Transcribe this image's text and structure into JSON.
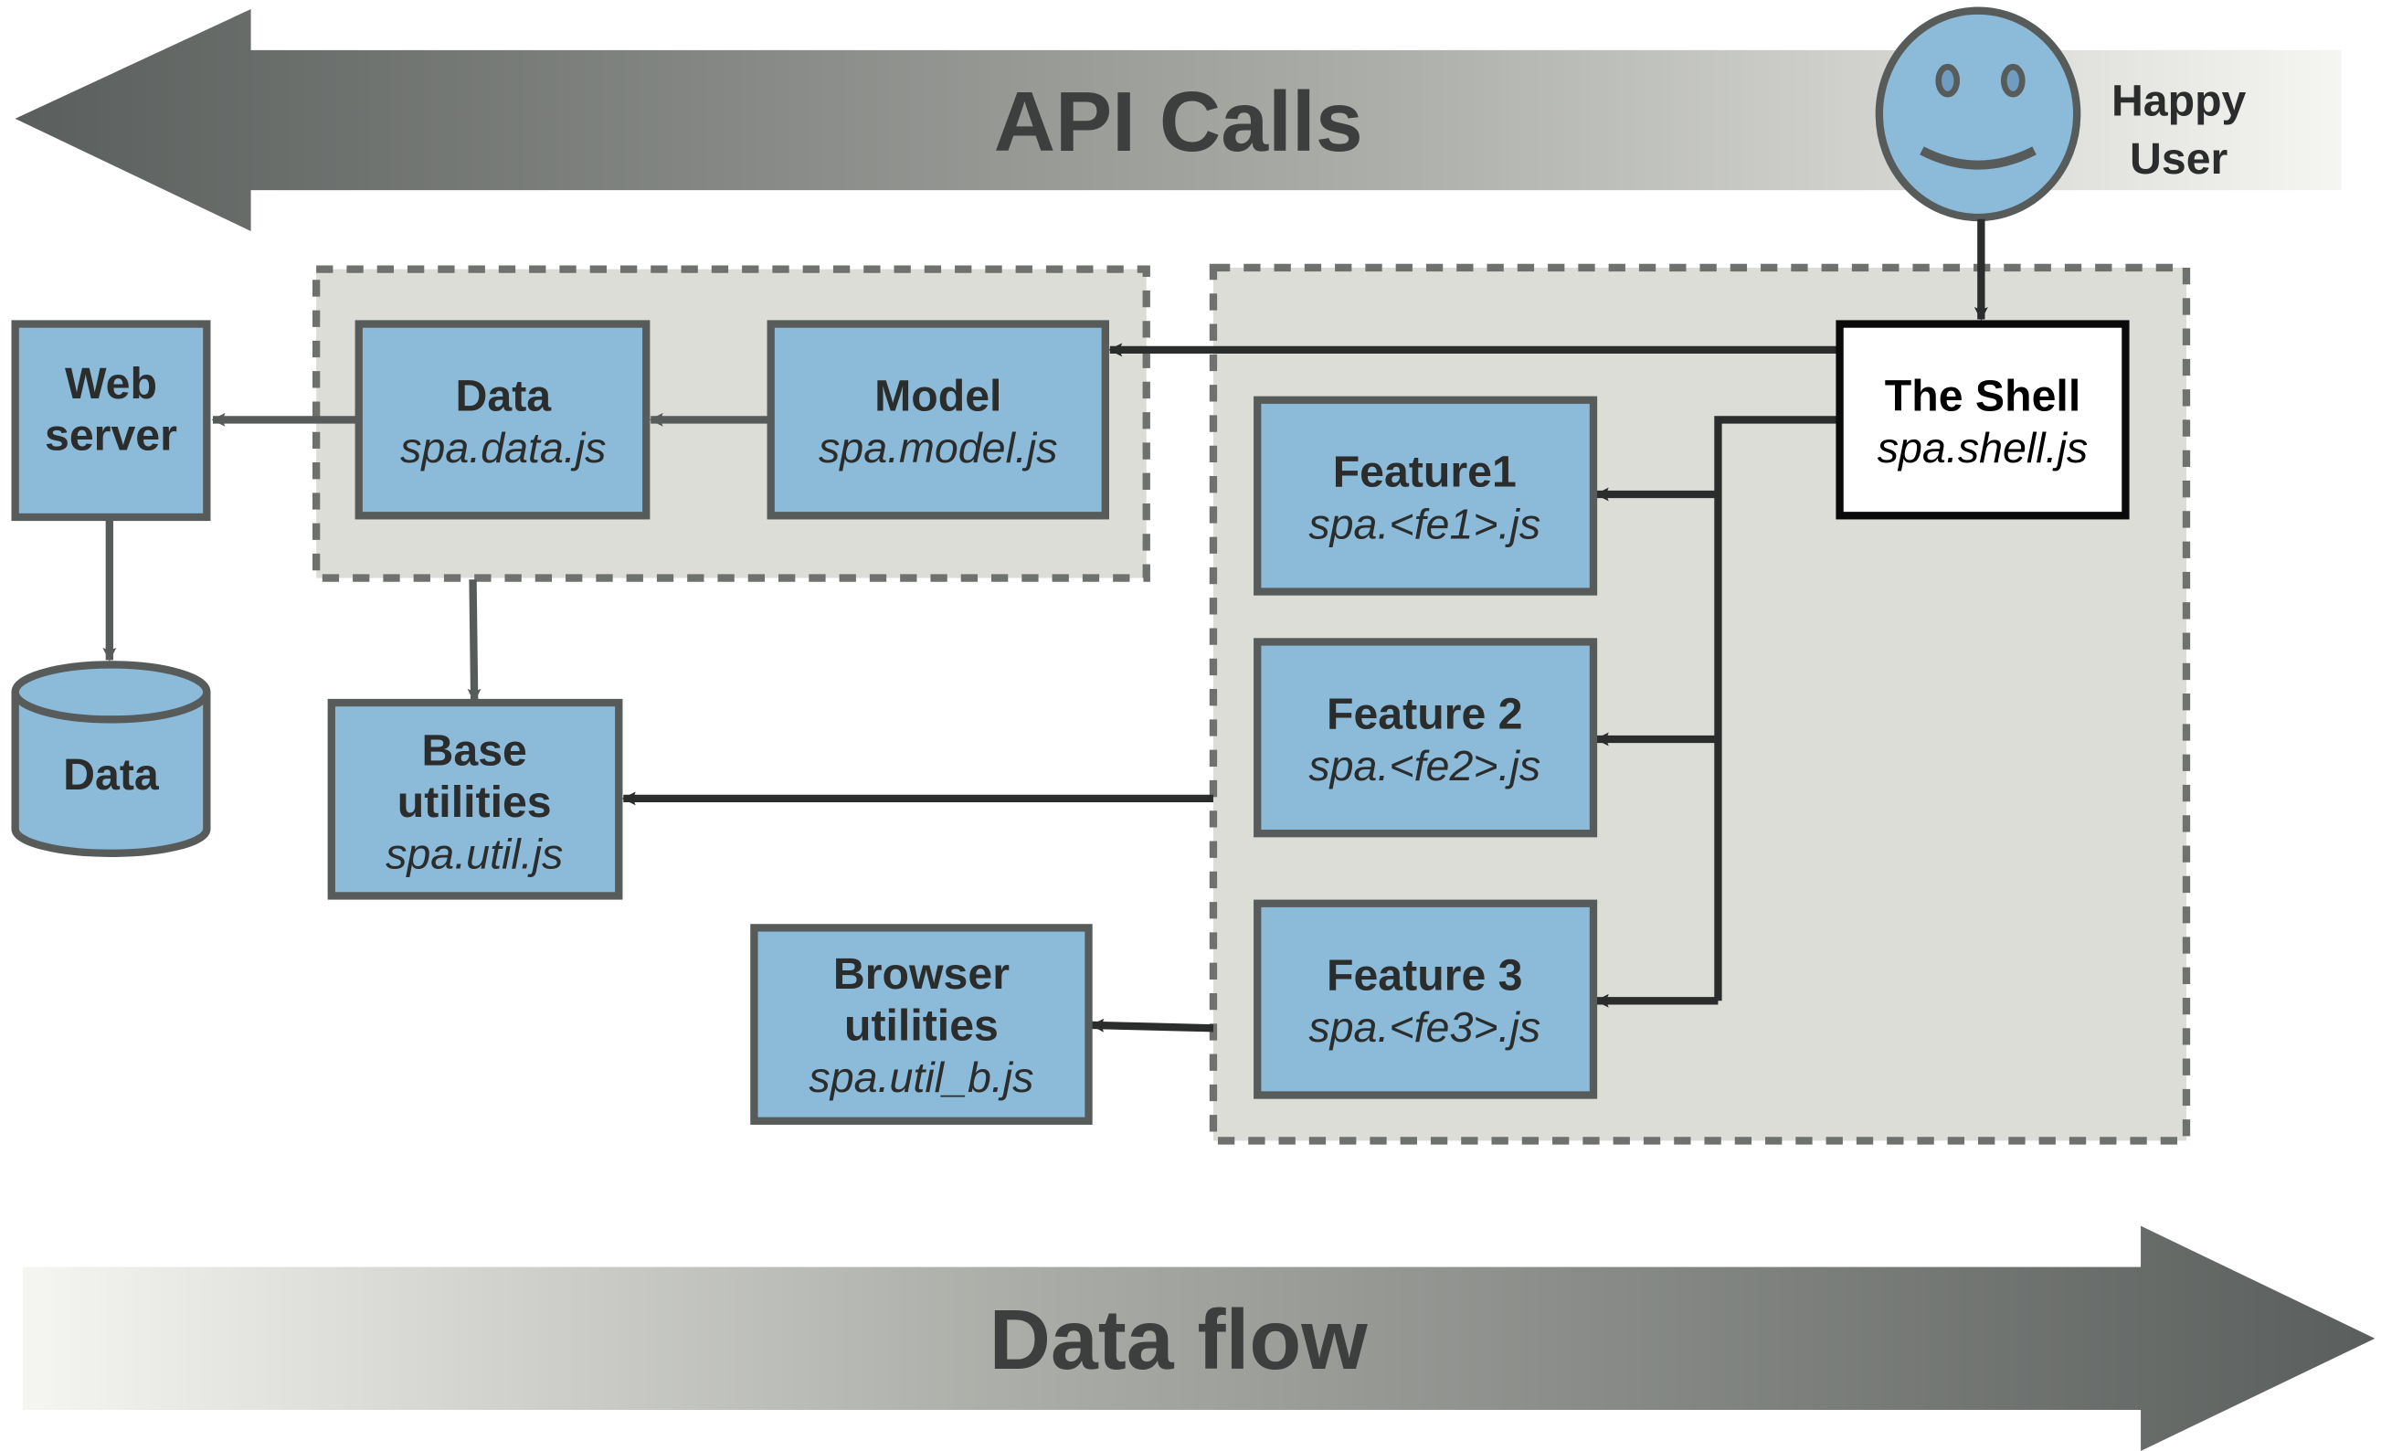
{
  "colors": {
    "box": "#8cbad9",
    "border": "#575c5b",
    "group": "#dcddd7",
    "arrow": "#2b2d2c",
    "banner_dark": "#5a5e5c"
  },
  "banners": {
    "api_calls": "API Calls",
    "data_flow": "Data flow"
  },
  "user": {
    "line1": "Happy",
    "line2": "User",
    "icon": "smiley-face-icon"
  },
  "nodes": {
    "web_server": {
      "line1": "Web",
      "line2": "server"
    },
    "database": {
      "label": "Data"
    },
    "data": {
      "title": "Data",
      "file": "spa.data.js"
    },
    "model": {
      "title": "Model",
      "file": "spa.model.js"
    },
    "shell": {
      "title": "The Shell",
      "file": "spa.shell.js"
    },
    "feature1": {
      "title": "Feature1",
      "file": "spa.<fe1>.js"
    },
    "feature2": {
      "title": "Feature 2",
      "file": "spa.<fe2>.js"
    },
    "feature3": {
      "title": "Feature 3",
      "file": "spa.<fe3>.js"
    },
    "base_util": {
      "line1": "Base",
      "line2": "utilities",
      "file": "spa.util.js"
    },
    "browser_util": {
      "line1": "Browser",
      "line2": "utilities",
      "file": "spa.util_b.js"
    }
  }
}
